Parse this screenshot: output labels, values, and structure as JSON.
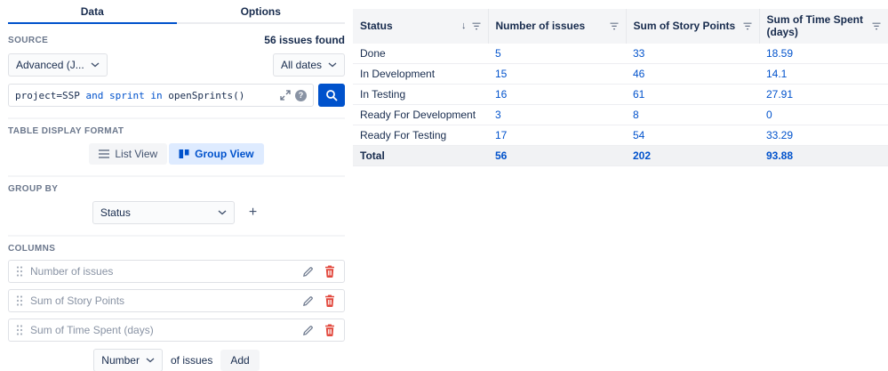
{
  "colors": {
    "accent": "#0052CC",
    "link": "#0052CC",
    "danger": "#E2483D",
    "selected": "#DEEBFF"
  },
  "icons": {
    "help_glyph": "?",
    "plus": "+",
    "sort_desc": "↓"
  },
  "left": {
    "tabs": [
      {
        "label": "Data",
        "active": true
      },
      {
        "label": "Options",
        "active": false
      }
    ],
    "source": {
      "label": "SOURCE",
      "issues_found": "56 issues found",
      "advanced_value": "Advanced (J...",
      "dates_value": "All dates",
      "jql_tokens": [
        {
          "text": "project=SSP ",
          "type": "plain"
        },
        {
          "text": "and ",
          "type": "keyword"
        },
        {
          "text": "sprint ",
          "type": "keyword"
        },
        {
          "text": "in ",
          "type": "keyword"
        },
        {
          "text": "openSprints()",
          "type": "plain"
        }
      ]
    },
    "table_display": {
      "label": "TABLE DISPLAY FORMAT",
      "list_view": "List View",
      "group_view": "Group View",
      "selected": "Group View"
    },
    "group_by": {
      "label": "GROUP BY",
      "value": "Status"
    },
    "columns": {
      "label": "COLUMNS",
      "items": [
        "Number of issues",
        "Sum of Story Points",
        "Sum of Time Spent (days)"
      ]
    },
    "footer": {
      "metric_value": "Number",
      "suffix": "of issues",
      "add_label": "Add"
    }
  },
  "table": {
    "headers": [
      {
        "label": "Status",
        "sorted": "desc",
        "filter": true
      },
      {
        "label": "Number of issues",
        "filter": true
      },
      {
        "label": "Sum of Story Points",
        "filter": true
      },
      {
        "label": "Sum of Time Spent (days)",
        "filter": true
      }
    ],
    "rows": [
      {
        "status": "Done",
        "number_of_issues": "5",
        "story_points": "33",
        "time_spent": "18.59"
      },
      {
        "status": "In Development",
        "number_of_issues": "15",
        "story_points": "46",
        "time_spent": "14.1"
      },
      {
        "status": "In Testing",
        "number_of_issues": "16",
        "story_points": "61",
        "time_spent": "27.91"
      },
      {
        "status": "Ready For Development",
        "number_of_issues": "3",
        "story_points": "8",
        "time_spent": "0"
      },
      {
        "status": "Ready For Testing",
        "number_of_issues": "17",
        "story_points": "54",
        "time_spent": "33.29"
      }
    ],
    "total_row": {
      "status": "Total",
      "number_of_issues": "56",
      "story_points": "202",
      "time_spent": "93.88"
    }
  }
}
